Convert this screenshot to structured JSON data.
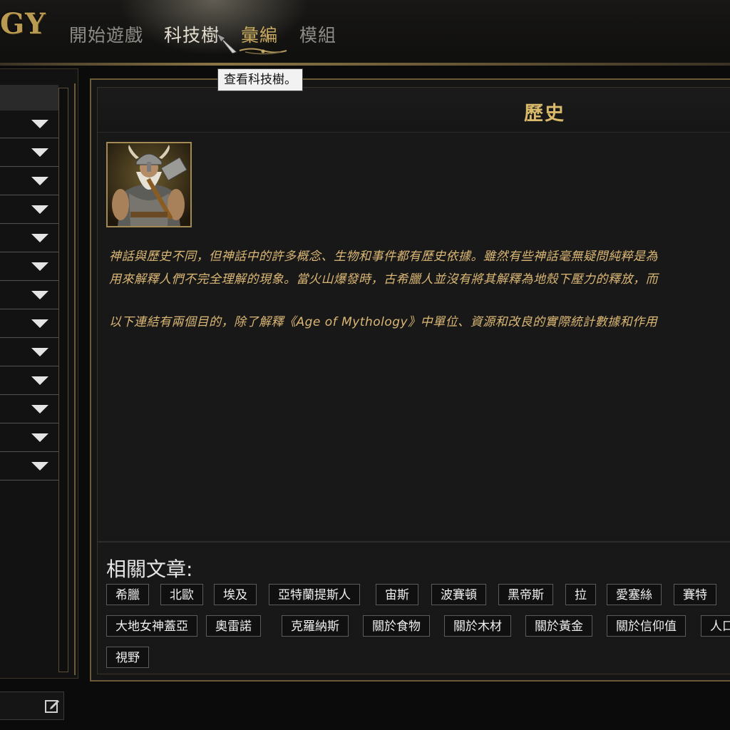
{
  "header": {
    "logo_text": "GY",
    "nav": [
      {
        "label": "開始遊戲"
      },
      {
        "label": "科技樹"
      },
      {
        "label": "彙編"
      },
      {
        "label": "模組"
      }
    ],
    "tooltip": "查看科技樹。"
  },
  "left_panel": {
    "row_count": 13,
    "row_icon": "chevron-down-icon",
    "edit_icon": "edit-icon"
  },
  "main": {
    "title": "歷史",
    "portrait_icon": "norse-warrior-portrait",
    "paragraphs": [
      "神話與歷史不同，但神話中的許多概念、生物和事件都有歷史依據。雖然有些神話毫無疑問純粹是為",
      "用來解釋人們不完全理解的現象。當火山爆發時，古希臘人並沒有將其解釋為地殼下壓力的釋放，而",
      "以下連結有兩個目的，除了解釋《Age of Mythology》中單位、資源和改良的實際統計數據和作用"
    ],
    "related_heading": "相關文章:",
    "related_rows": [
      [
        "希臘",
        "北歐",
        "埃及",
        "亞特蘭提斯人",
        "宙斯",
        "波賽頓",
        "黑帝斯",
        "拉",
        "愛塞絲",
        "賽特"
      ],
      [
        "大地女神蓋亞",
        "奧雷諾",
        "克羅納斯",
        "關於食物",
        "關於木材",
        "關於黃金",
        "關於信仰值",
        "人口"
      ],
      [
        "視野"
      ]
    ]
  },
  "colors": {
    "accent_gold": "#d9b96a",
    "body_text": "#dbb775",
    "frame_gold": "#6b5a36"
  }
}
